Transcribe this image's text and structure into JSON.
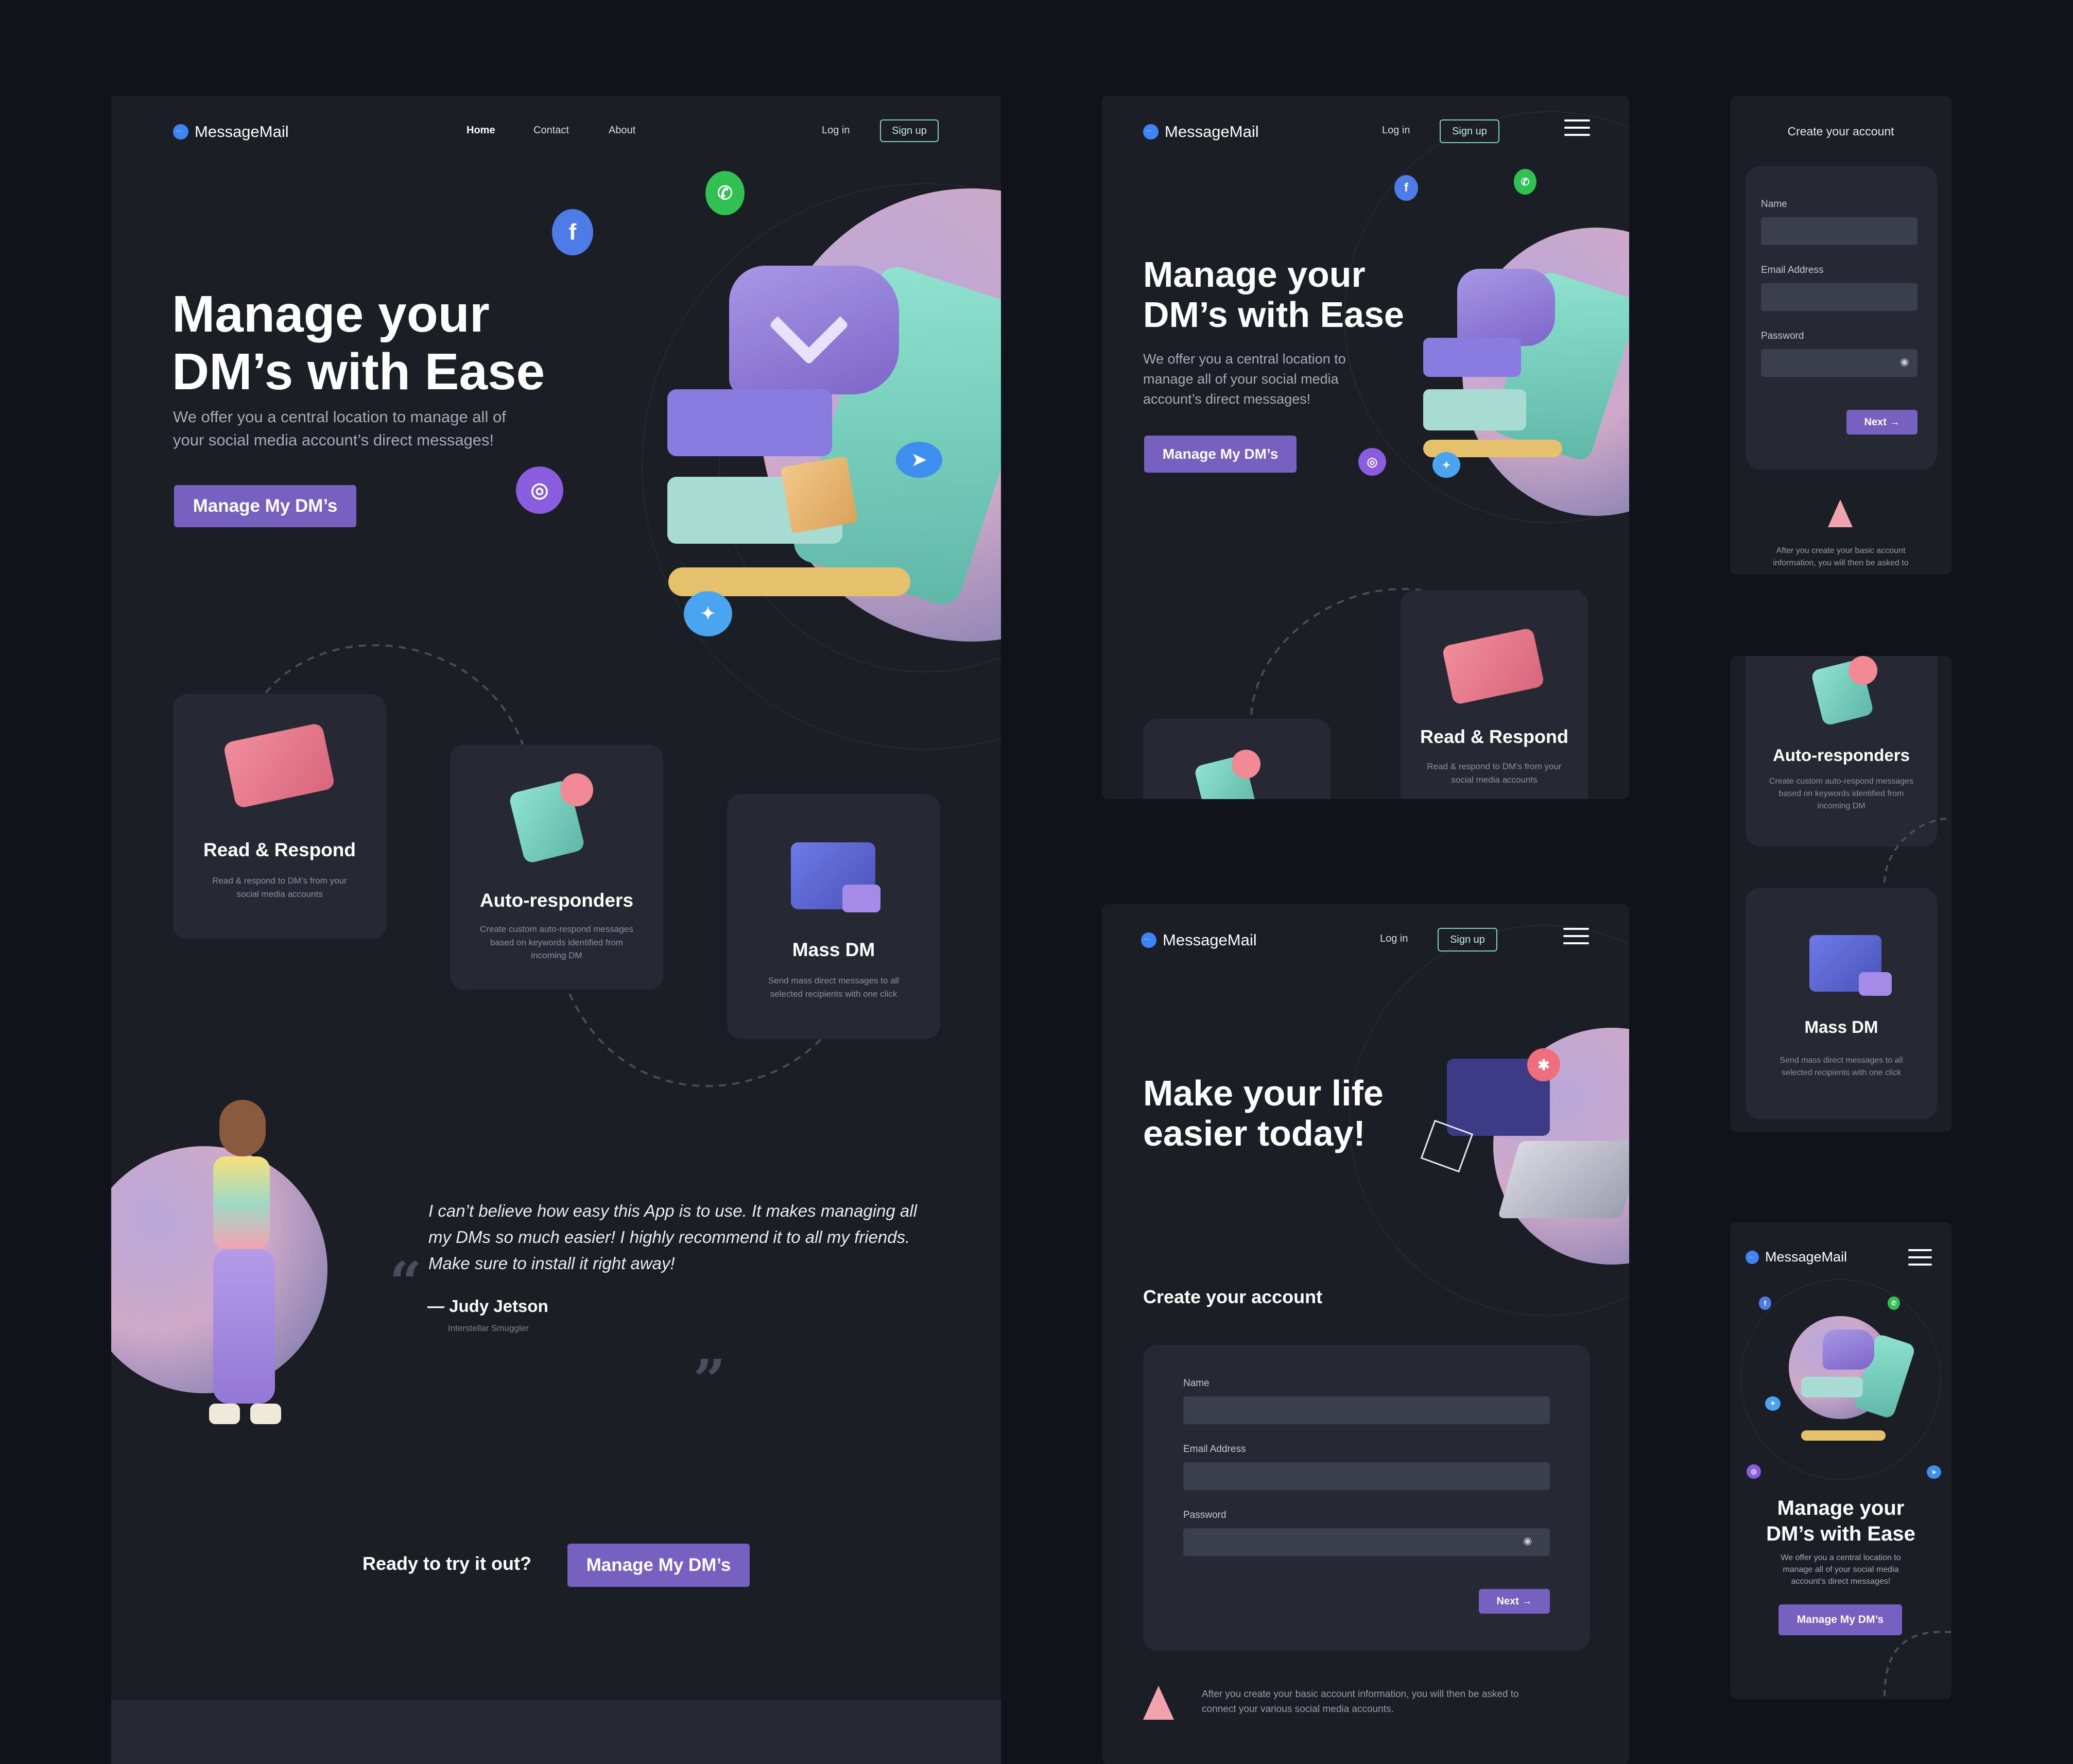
{
  "brand": {
    "name": "MessageMail"
  },
  "nav": {
    "home": "Home",
    "contact": "Contact",
    "about": "About",
    "login": "Log in",
    "signup": "Sign up"
  },
  "hero": {
    "title_line1": "Manage your",
    "title_line2": "DM’s with Ease",
    "subtitle_line1": "We offer you a central location to manage all of",
    "subtitle_line2": "your social media account’s direct messages!",
    "cta": "Manage My DM’s"
  },
  "features": [
    {
      "title": "Read & Respond",
      "desc_line1": "Read & respond to DM’s from your",
      "desc_line2": "social media accounts",
      "desc_line3": ""
    },
    {
      "title": "Auto-responders",
      "desc_line1": "Create custom auto-respond messages",
      "desc_line2": "based on keywords identified from",
      "desc_line3": "incoming DM"
    },
    {
      "title": "Mass DM",
      "desc_line1": "Send mass direct messages to all",
      "desc_line2": "selected recipients with one click",
      "desc_line3": ""
    }
  ],
  "testimonial": {
    "quote_line1": "I can’t believe how easy this App is to use. It makes managing all",
    "quote_line2": "my DMs so much easier! I highly recommend it to all my friends.",
    "quote_line3": "Make sure to install it right away!",
    "author": "Judy Jetson",
    "role": "Interstellar Smuggler"
  },
  "cta_bottom": {
    "text": "Ready to try it out?",
    "button": "Manage My DM’s"
  },
  "tablet_hero": {
    "subtitle_line1": "We offer you a central location to",
    "subtitle_line2": "manage all of your social media",
    "subtitle_line3": "account’s direct messages!"
  },
  "tablet_feature": {
    "desc_line1": "Read & respond to DM’s from your",
    "desc_line2": "social media accounts"
  },
  "signup_page": {
    "headline_line1": "Make your life",
    "headline_line2": "easier today!",
    "form_title": "Create your account",
    "name_label": "Name",
    "email_label": "Email Address",
    "password_label": "Password",
    "next": "Next →",
    "note_line1": "After you create your basic account information, you will then be asked to",
    "note_line2": "connect your various social media accounts."
  },
  "mobile_form": {
    "title": "Create your account",
    "note_line1": "After you create your basic account",
    "note_line2": "information, you will then be asked to"
  },
  "mobile_hero": {
    "title_line1": "Manage your",
    "title_line2": "DM’s with Ease",
    "sub_line1": "We offer you a central location to",
    "sub_line2": "manage all of your social media",
    "sub_line3": "account’s direct messages!",
    "cta": "Manage My DM’s"
  },
  "icons": {
    "chat": "chat-bubble-icon",
    "menu": "hamburger-menu-icon",
    "eye": "eye-icon",
    "warning": "warning-icon",
    "facebook": "facebook-icon",
    "whatsapp": "whatsapp-icon",
    "instagram": "instagram-icon",
    "twitter": "twitter-icon",
    "telegram": "telegram-icon"
  },
  "colors": {
    "background": "#11131a",
    "panel": "#1c1e26",
    "card": "#262833",
    "accent": "#7660c0",
    "signup_border": "#7fd1c0"
  }
}
